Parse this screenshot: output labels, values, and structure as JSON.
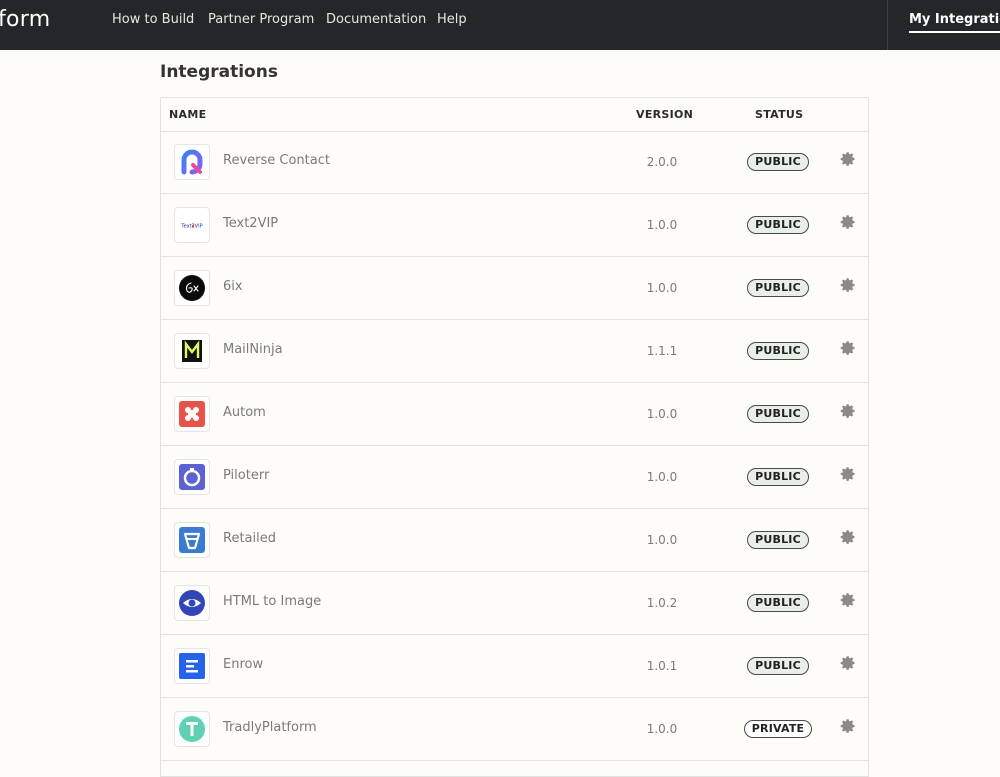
{
  "topbar": {
    "brand": "form",
    "nav": [
      "How to Build",
      "Partner Program",
      "Documentation",
      "Help"
    ],
    "my_integrations": "My Integrations"
  },
  "page": {
    "title": "Integrations"
  },
  "table": {
    "columns": {
      "name": "NAME",
      "version": "VERSION",
      "status": "STATUS"
    },
    "rows": [
      {
        "name": "Reverse Contact",
        "version": "2.0.0",
        "status": "PUBLIC",
        "icon": "reverse-contact-logo-icon"
      },
      {
        "name": "Text2VIP",
        "version": "1.0.0",
        "status": "PUBLIC",
        "icon": "text2vip-logo-icon",
        "logo_text": "Text2VIP"
      },
      {
        "name": "6ix",
        "version": "1.0.0",
        "status": "PUBLIC",
        "icon": "6ix-logo-icon"
      },
      {
        "name": "MailNinja",
        "version": "1.1.1",
        "status": "PUBLIC",
        "icon": "mailninja-logo-icon"
      },
      {
        "name": "Autom",
        "version": "1.0.0",
        "status": "PUBLIC",
        "icon": "autom-logo-icon"
      },
      {
        "name": "Piloterr",
        "version": "1.0.0",
        "status": "PUBLIC",
        "icon": "piloterr-logo-icon"
      },
      {
        "name": "Retailed",
        "version": "1.0.0",
        "status": "PUBLIC",
        "icon": "retailed-logo-icon"
      },
      {
        "name": "HTML to Image",
        "version": "1.0.2",
        "status": "PUBLIC",
        "icon": "html-to-image-logo-icon"
      },
      {
        "name": "Enrow",
        "version": "1.0.1",
        "status": "PUBLIC",
        "icon": "enrow-logo-icon"
      },
      {
        "name": "TradlyPlatform",
        "version": "1.0.0",
        "status": "PRIVATE",
        "icon": "tradly-logo-icon"
      }
    ]
  },
  "colors": {
    "topbar_bg": "#23272a",
    "page_bg": "#fdfcf8",
    "public_badge_bg": "#e8efe6",
    "private_badge_bg": "#ffffff"
  }
}
